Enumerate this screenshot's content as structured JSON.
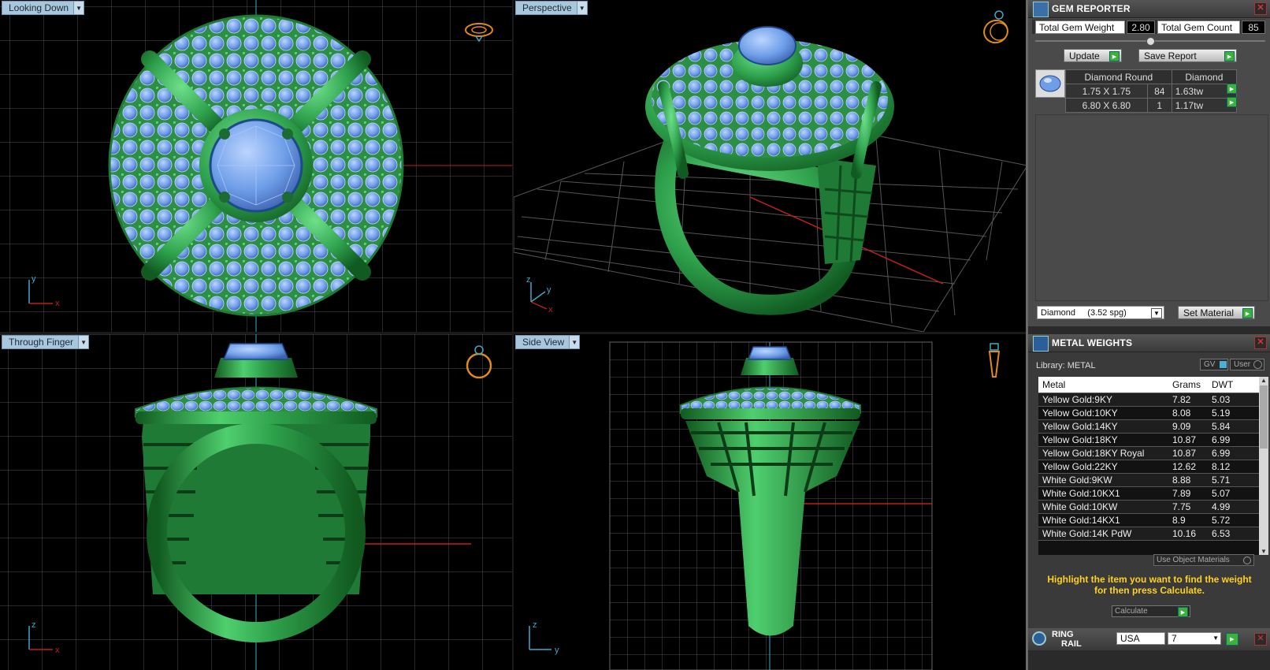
{
  "viewports": {
    "top_left": {
      "label": "Looking Down"
    },
    "top_right": {
      "label": "Perspective"
    },
    "bottom_left": {
      "label": "Through Finger"
    },
    "bottom_right": {
      "label": "Side View"
    }
  },
  "gem_reporter": {
    "title": "GEM REPORTER",
    "total_weight_label": "Total Gem Weight",
    "total_weight_value": "2.80",
    "total_count_label": "Total Gem Count",
    "total_count_value": "85",
    "update_label": "Update",
    "save_report_label": "Save Report",
    "headers": [
      "Diamond Round",
      "Diamond"
    ],
    "rows": [
      {
        "size": "1.75 X 1.75",
        "count": "84",
        "weight": "1.63tw"
      },
      {
        "size": "6.80 X 6.80",
        "count": "1",
        "weight": "1.17tw"
      }
    ],
    "material_select": "Diamond     (3.52 spg)",
    "set_material_label": "Set Material"
  },
  "metal_weights": {
    "title": "METAL WEIGHTS",
    "library_label": "Library: METAL",
    "gv_label": "GV",
    "user_label": "User",
    "headers": [
      "Metal",
      "Grams",
      "DWT"
    ],
    "rows": [
      {
        "metal": "Yellow Gold:9KY",
        "grams": "7.82",
        "dwt": "5.03"
      },
      {
        "metal": "Yellow Gold:10KY",
        "grams": "8.08",
        "dwt": "5.19"
      },
      {
        "metal": "Yellow Gold:14KY",
        "grams": "9.09",
        "dwt": "5.84"
      },
      {
        "metal": "Yellow Gold:18KY",
        "grams": "10.87",
        "dwt": "6.99"
      },
      {
        "metal": "Yellow Gold:18KY Royal",
        "grams": "10.87",
        "dwt": "6.99"
      },
      {
        "metal": "Yellow Gold:22KY",
        "grams": "12.62",
        "dwt": "8.12"
      },
      {
        "metal": "White Gold:9KW",
        "grams": "8.88",
        "dwt": "5.71"
      },
      {
        "metal": "White Gold:10KX1",
        "grams": "7.89",
        "dwt": "5.07"
      },
      {
        "metal": "White Gold:10KW",
        "grams": "7.75",
        "dwt": "4.99"
      },
      {
        "metal": "White Gold:14KX1",
        "grams": "8.9",
        "dwt": "5.72"
      },
      {
        "metal": "White Gold:14K PdW",
        "grams": "10.16",
        "dwt": "6.53"
      }
    ],
    "use_object_materials_label": "Use Object Materials",
    "hint": "Highlight the item you want to find the weight for then press Calculate.",
    "calculate_label": "Calculate"
  },
  "ring_rail": {
    "title_line1": "RING",
    "title_line2": "RAIL",
    "country_value": "USA",
    "size_value": "7"
  },
  "colors": {
    "metal": "#2d9e4a",
    "gem": "#6e9ee8",
    "grid": "#505050",
    "axis_red": "#c0201a",
    "axis_blue": "#3fa7c9",
    "hint_text": "#ffd21e"
  }
}
